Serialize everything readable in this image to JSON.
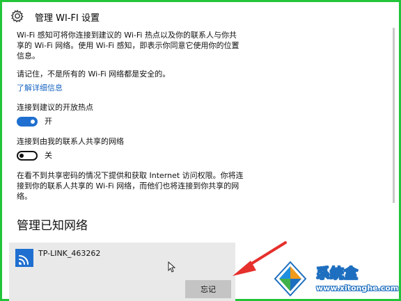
{
  "window": {
    "title": "管理 WI-FI 设置",
    "border_color": "#22c538"
  },
  "content": {
    "intro_line1": "Wi-Fi 感知可将你连接到建议的 Wi-Fi 热点以及你的联系人与你共",
    "intro_line2": "享的 Wi-Fi 网络。使用 Wi-Fi 感知，即表示你同意它使用你的位置",
    "intro_line3": "信息。",
    "warning": "请记住，不是所有的 Wi-Fi 网络都是安全的。",
    "learn_more_link": "了解详细信息",
    "hotspots": {
      "label": "连接到建议的开放热点",
      "state": "开",
      "on": true
    },
    "contacts": {
      "label": "连接到由我的联系人共享的网络",
      "state": "关",
      "on": false
    },
    "note_line1": "在看不到共享密码的情况下提供和获取 Internet 访问权限。你将连",
    "note_line2": "接到你的联系人共享的 Wi-Fi 网络，而他们也将连接到你共享的网",
    "note_line3": "络。"
  },
  "known_networks": {
    "heading": "管理已知网络",
    "networks": [
      {
        "name": "TP-LINK_463262",
        "icon": "wifi-icon",
        "forget_label": "忘记"
      }
    ]
  },
  "watermark": {
    "title": "系统盒",
    "url": "www.xitonghe.com"
  },
  "colors": {
    "accent": "#1f6fd0",
    "link": "#1a66c2",
    "annotation_arrow": "#e5302c"
  }
}
